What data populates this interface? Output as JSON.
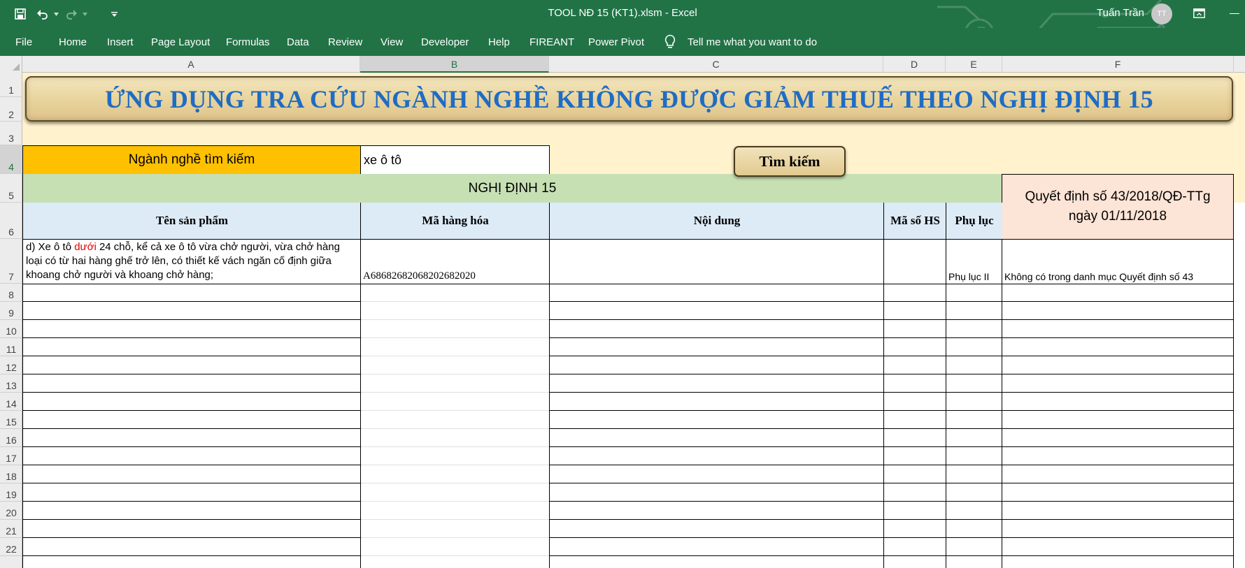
{
  "window": {
    "title": "TOOL NĐ 15 (KT1).xlsm  -  Excel",
    "user_name": "Tuấn Trần",
    "avatar_initials": "TT",
    "quick_access": [
      "save-icon",
      "undo-icon",
      "redo-icon",
      "customize-icon"
    ]
  },
  "ribbon": {
    "tabs": [
      "File",
      "Home",
      "Insert",
      "Page Layout",
      "Formulas",
      "Data",
      "Review",
      "View",
      "Developer",
      "Help",
      "FIREANT",
      "Power Pivot"
    ],
    "tell_me": "Tell me what you want to do"
  },
  "grid": {
    "columns": [
      "A",
      "B",
      "C",
      "D",
      "E",
      "F"
    ],
    "selected_column": "B",
    "rows": [
      "1",
      "2",
      "3",
      "4",
      "5",
      "6",
      "7",
      "8",
      "9",
      "10",
      "11",
      "12",
      "13",
      "14",
      "15",
      "16",
      "17",
      "18",
      "19",
      "20",
      "21",
      "22"
    ],
    "selected_row": "4"
  },
  "sheet": {
    "title": "ỨNG DỤNG TRA CỨU NGÀNH NGHỀ KHÔNG ĐƯỢC GIẢM THUẾ THEO NGHỊ ĐỊNH 15",
    "search_label": "Ngành nghề tìm kiếm",
    "search_value": "xe ô tô",
    "search_button": "Tìm kiếm",
    "section_header": "NGHỊ ĐỊNH 15",
    "decision_header": "Quyết định số 43/2018/QĐ-TTg ngày 01/11/2018",
    "headers": {
      "product_name": "Tên sản phẩm",
      "goods_code": "Mã hàng hóa",
      "content": "Nội dung",
      "hs_code": "Mã số HS",
      "appendix": "Phụ lục"
    },
    "result": {
      "product_prefix": "d) Xe ô tô ",
      "product_highlight": "dưới",
      "product_suffix": " 24 chỗ, kể cả xe ô tô vừa chở người, vừa chở hàng loại có từ hai hàng ghế trở lên, có thiết kế vách ngăn cố định giữa khoang chở người và khoang chở hàng;",
      "goods_code": "A6868268206820268202­0",
      "content": "",
      "hs_code": "",
      "appendix": "Phụ lục II",
      "decision_note": "Không có trong danh mục Quyết định số 43"
    }
  },
  "colors": {
    "excel_green": "#217346",
    "search_label_bg": "#ffc000",
    "section_bg": "#c6e0b4",
    "header_bg": "#ddebf7",
    "decision_bg": "#fce4d6",
    "sheet_bg": "#fff2cc",
    "title_blue": "#1f6cc4",
    "highlight_red": "#e00000"
  }
}
